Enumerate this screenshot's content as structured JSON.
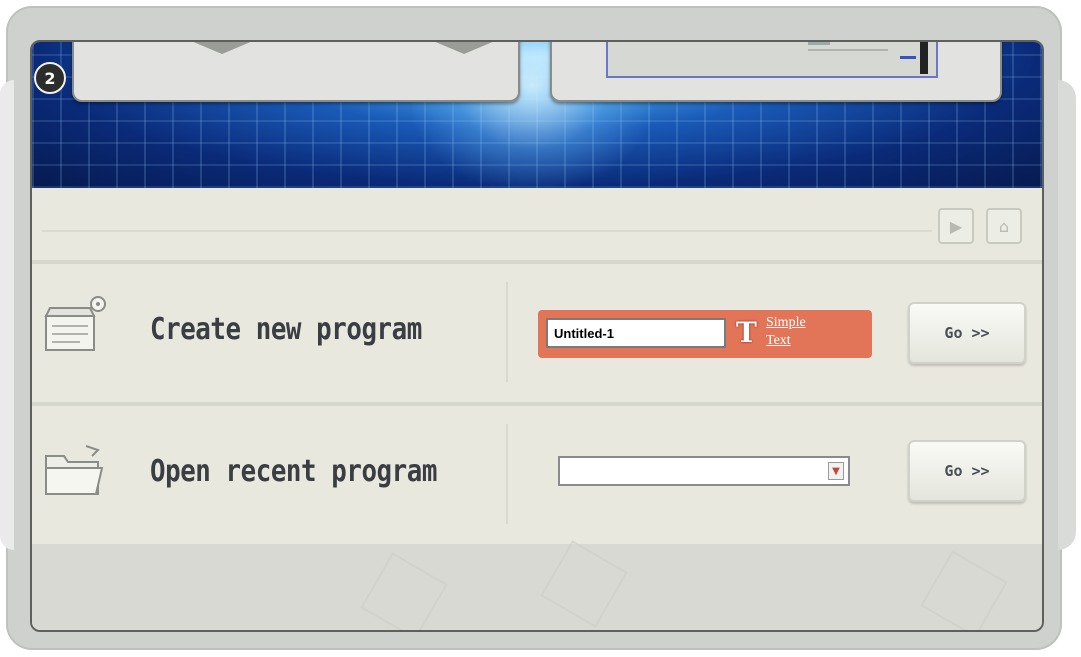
{
  "step": {
    "badge": "2"
  },
  "nav": {
    "forward_icon": "play-arrow-icon",
    "home_icon": "home-icon"
  },
  "create": {
    "label": "Create new program",
    "icon": "new-document-icon",
    "name_value": "Untitled-1",
    "link_text_line1": "Simple",
    "link_text_line2": "Text",
    "link_icon": "text-tool-icon",
    "go_label": "Go >>",
    "accent_color": "#e27457"
  },
  "recent": {
    "label": "Open recent program",
    "icon": "open-folder-icon",
    "selected_value": "",
    "go_label": "Go >>"
  }
}
